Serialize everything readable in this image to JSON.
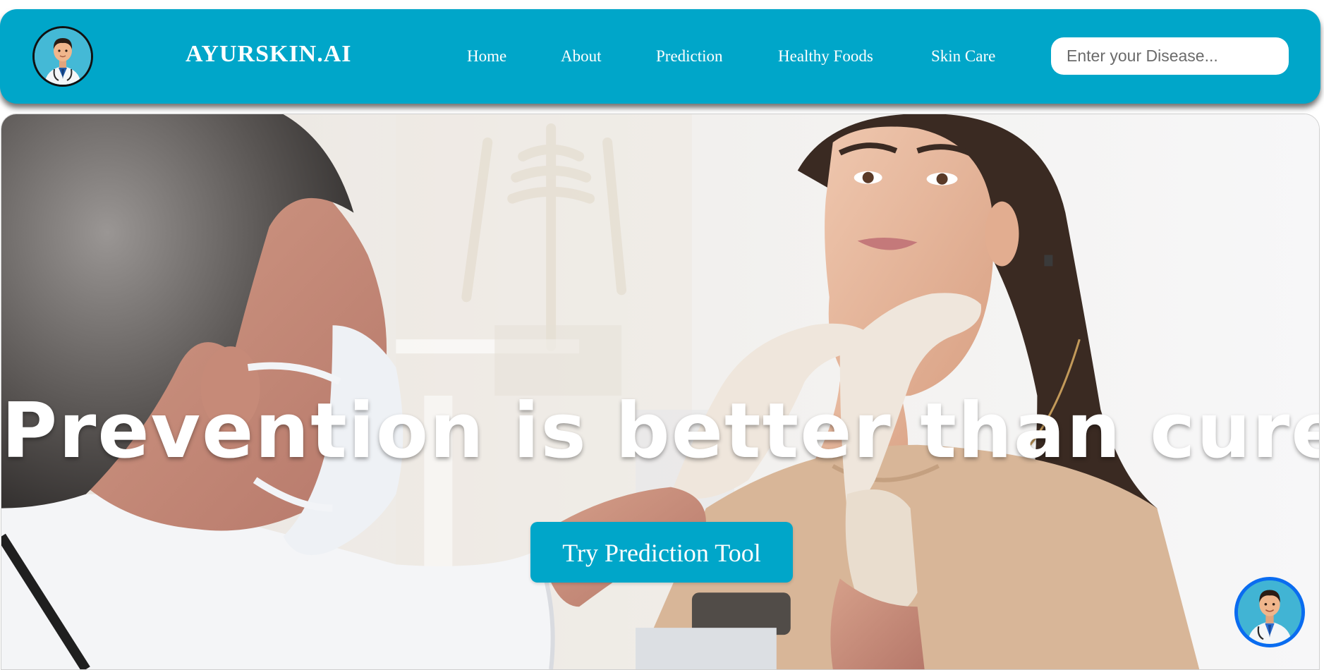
{
  "header": {
    "brand": "AYURSKIN.AI",
    "logo_icon": "doctor-avatar-icon",
    "nav": [
      {
        "label": "Home"
      },
      {
        "label": "About"
      },
      {
        "label": "Prediction"
      },
      {
        "label": "Healthy Foods"
      },
      {
        "label": "Skin Care"
      }
    ],
    "search": {
      "placeholder": "Enter your Disease...",
      "value": ""
    }
  },
  "hero": {
    "title": "Prevention is better than cure",
    "cta_label": "Try Prediction Tool",
    "image": "doctor-examining-patient-photo"
  },
  "chat": {
    "icon": "doctor-avatar-icon"
  },
  "colors": {
    "primary": "#00a6c9",
    "chat_ring": "#0a6cf0",
    "text_light": "#ffffff"
  }
}
